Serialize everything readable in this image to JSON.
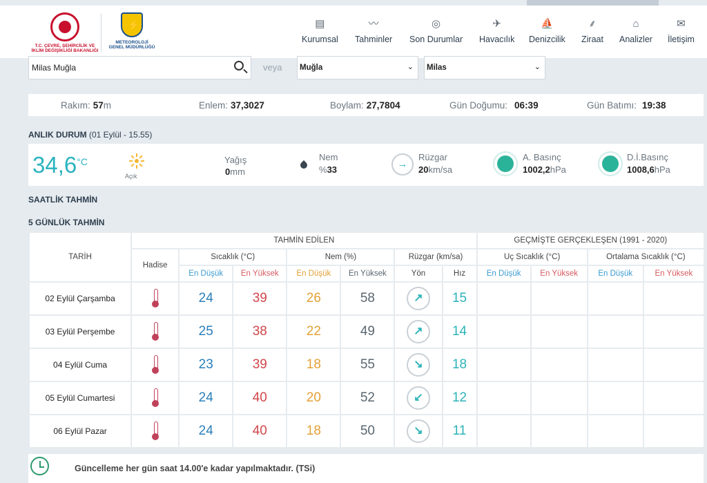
{
  "logos": {
    "ministry": "T.C. ÇEVRE, ŞEHİRCİLİK VE İKLİM DEĞİŞİKLİĞİ BAKANLIĞI",
    "mgm": "METEOROLOJİ GENEL MÜDÜRLÜĞÜ"
  },
  "nav": [
    {
      "label": "Kurumsal",
      "icon": "document-icon"
    },
    {
      "label": "Tahminler",
      "icon": "chart-icon"
    },
    {
      "label": "Son Durumlar",
      "icon": "check-circle-icon"
    },
    {
      "label": "Havacılık",
      "icon": "plane-icon"
    },
    {
      "label": "Denizcilik",
      "icon": "sail-icon"
    },
    {
      "label": "Ziraat",
      "icon": "wheat-icon"
    },
    {
      "label": "Analizler",
      "icon": "analysis-icon"
    },
    {
      "label": "İletişim",
      "icon": "mail-icon"
    }
  ],
  "search": {
    "value": "Milas Muğla",
    "or_label": "veya"
  },
  "selects": {
    "province": "Muğla",
    "district": "Milas"
  },
  "info": {
    "altitude_label": "Rakım:",
    "altitude_value": "57",
    "altitude_unit": "m",
    "lat_label": "Enlem:",
    "lat_value": "37,3027",
    "lon_label": "Boylam:",
    "lon_value": "27,7804",
    "sunrise_label": "Gün Doğumu:",
    "sunrise_value": "06:39",
    "sunset_label": "Gün Batımı:",
    "sunset_value": "19:38"
  },
  "now": {
    "title": "ANLIK DURUM",
    "subtitle": "(01 Eylül - 15.55)",
    "temp": "34,6",
    "temp_unit": "°C",
    "sky": "Açık",
    "rain_label": "Yağış",
    "rain_value": "0",
    "rain_unit": "mm",
    "humidity_label": "Nem",
    "humidity_prefix": "%",
    "humidity_value": "33",
    "wind_label": "Rüzgar",
    "wind_value": "20",
    "wind_unit": "km/sa",
    "pressure_label": "A. Basınç",
    "pressure_value": "1002,2",
    "pressure_unit": "hPa",
    "sea_pressure_label": "D.İ.Basınç",
    "sea_pressure_value": "1008,6",
    "sea_pressure_unit": "hPa"
  },
  "hourly_title": "SAATLİK TAHMİN",
  "daily_title": "5 GÜNLÜK TAHMİN",
  "table": {
    "date_header": "TARİH",
    "forecast_header": "TAHMİN EDİLEN",
    "history_header": "GEÇMİŞTE GERÇEKLEŞEN (1991 - 2020)",
    "event_header": "Hadise",
    "temp_header": "Sıcaklık (°C)",
    "hum_header": "Nem (%)",
    "wind_header": "Rüzgar (km/sa)",
    "extreme_header": "Uç Sıcaklık (°C)",
    "avg_header": "Ortalama Sıcaklık (°C)",
    "low": "En Düşük",
    "high": "En Yüksek",
    "dir": "Yön",
    "speed": "Hız",
    "rows": [
      {
        "date": "02 Eylül Çarşamba",
        "tmin": "24",
        "tmax": "39",
        "hmin": "26",
        "hmax": "58",
        "dir": "↗",
        "speed": "15"
      },
      {
        "date": "03 Eylül Perşembe",
        "tmin": "25",
        "tmax": "38",
        "hmin": "22",
        "hmax": "49",
        "dir": "↗",
        "speed": "14"
      },
      {
        "date": "04 Eylül Cuma",
        "tmin": "23",
        "tmax": "39",
        "hmin": "18",
        "hmax": "55",
        "dir": "↘",
        "speed": "18"
      },
      {
        "date": "05 Eylül Cumartesi",
        "tmin": "24",
        "tmax": "40",
        "hmin": "20",
        "hmax": "52",
        "dir": "↙",
        "speed": "12"
      },
      {
        "date": "06 Eylül Pazar",
        "tmin": "24",
        "tmax": "40",
        "hmin": "18",
        "hmax": "50",
        "dir": "↘",
        "speed": "11"
      }
    ]
  },
  "footer": {
    "text": "Güncelleme her gün saat 14.00'e kadar yapılmaktadır. (TSi)"
  }
}
